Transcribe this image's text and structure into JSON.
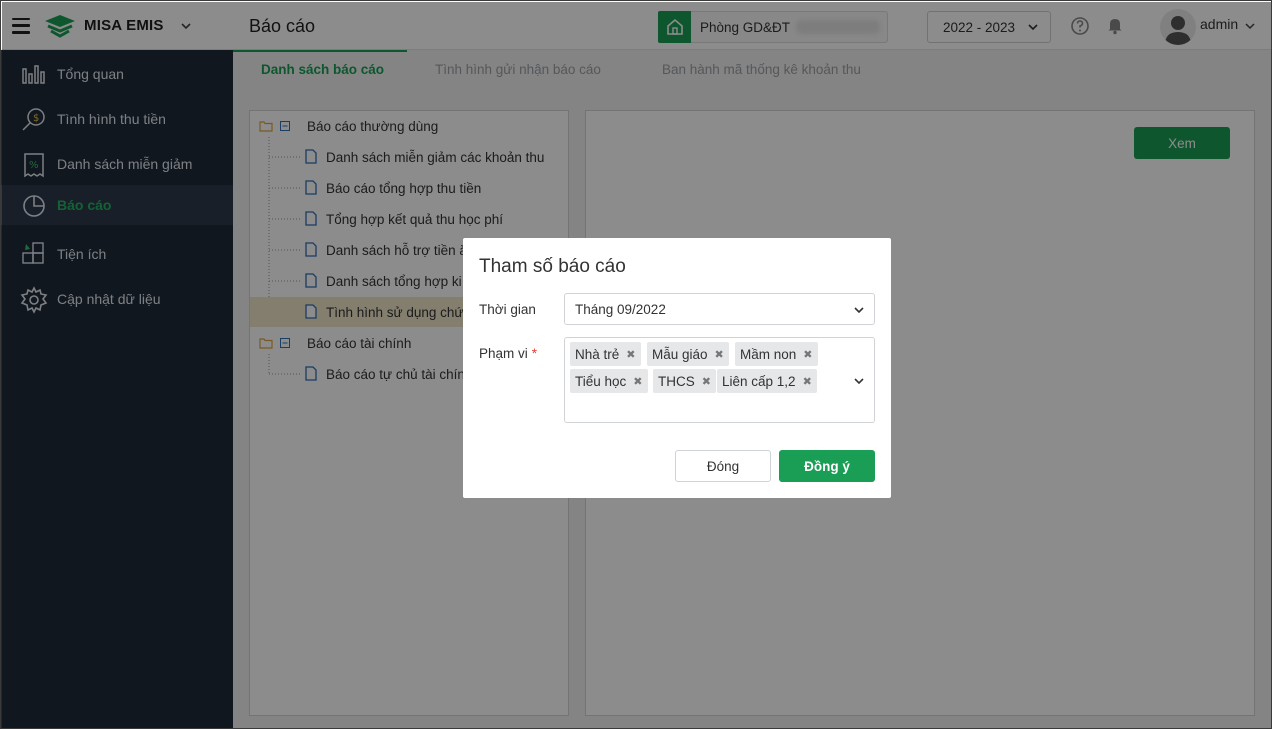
{
  "header": {
    "brand": "MISA EMIS",
    "page_title": "Báo cáo",
    "school_label": "Phòng GD&ĐT",
    "year": "2022 - 2023",
    "user": "admin"
  },
  "sidebar": {
    "items": [
      {
        "label": "Tổng quan",
        "icon": "chart-bars-icon"
      },
      {
        "label": "Tình hình thu tiền",
        "icon": "money-search-icon"
      },
      {
        "label": "Danh sách miễn giảm",
        "icon": "discount-receipt-icon"
      },
      {
        "label": "Báo cáo",
        "icon": "pie-chart-icon",
        "active": true
      },
      {
        "label": "Tiện ích",
        "icon": "utilities-icon"
      },
      {
        "label": "Cập nhật dữ liệu",
        "icon": "gear-icon"
      }
    ]
  },
  "tabs": [
    {
      "label": "Danh sách báo cáo",
      "active": true
    },
    {
      "label": "Tình hình gửi nhận báo cáo"
    },
    {
      "label": "Ban hành mã thống kê khoản thu"
    }
  ],
  "tree": {
    "groups": [
      {
        "label": "Báo cáo thường dùng",
        "items": [
          "Danh sách miễn giảm các khoản thu",
          "Báo cáo tổng hợp thu tiền",
          "Tổng hợp kết quả thu học phí",
          "Danh sách hỗ trợ tiền ă",
          "Danh sách tổng hợp ki",
          "Tình hình sử dụng chứ"
        ]
      },
      {
        "label": "Báo cáo tài chính",
        "items": [
          "Báo cáo tự chủ tài chín"
        ]
      }
    ]
  },
  "view_button": "Xem",
  "dialog": {
    "title": "Tham số báo cáo",
    "time_label": "Thời gian",
    "time_value": "Tháng 09/2022",
    "scope_label": "Phạm vi",
    "required_mark": "*",
    "chips": [
      "Nhà trẻ",
      "Mẫu giáo",
      "Mầm non",
      "Tiểu học",
      "THCS",
      "Liên cấp 1,2"
    ],
    "close_label": "Đóng",
    "ok_label": "Đồng ý"
  },
  "colors": {
    "accent": "#1a9e55",
    "sidebar_bg": "#1e2a3a",
    "selected_row": "#f1e5c9"
  }
}
